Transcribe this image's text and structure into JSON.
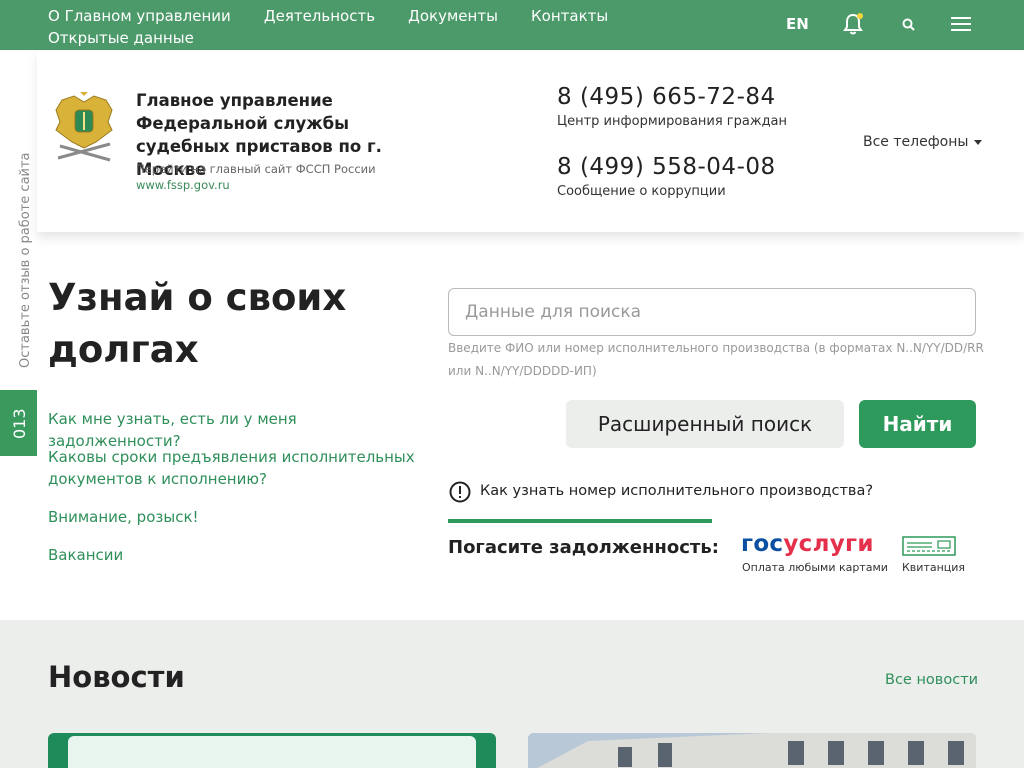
{
  "topnav": {
    "items": [
      "О Главном управлении",
      "Деятельность",
      "Документы",
      "Контакты",
      "Открытые данные"
    ],
    "lang": "EN",
    "accent": "#4c9a6a"
  },
  "header": {
    "org_title": "Главное управление Федеральной службы судебных приставов по г. Москве",
    "org_sub": "Перейти на главный сайт ФССП России",
    "org_link": "www.fssp.gov.ru",
    "phones": [
      {
        "number": "8 (495) 665-72-84",
        "label": "Центр информирования граждан"
      },
      {
        "number": "8 (499) 558-04-08",
        "label": "Сообщение о коррупции"
      }
    ],
    "all_phones": "Все телефоны"
  },
  "side": {
    "feedback": "Оставьте отзыв о работе сайта",
    "tab": "013"
  },
  "debt": {
    "title": "Узнай о своих долгах",
    "faq": [
      "Как мне узнать, есть ли у меня задолженности?",
      "Каковы сроки предъявления исполнительных документов к исполнению?",
      "Внимание, розыск!",
      "Вакансии"
    ],
    "search_placeholder": "Данные для поиска",
    "search_hint": "Введите ФИО или номер исполнительного производства (в форматах N..N/YY/DD/RR или N..N/YY/DDDDD-ИП)",
    "advanced_label": "Расширенный поиск",
    "find_label": "Найти",
    "help_link": "Как узнать номер исполнительного производства?",
    "pay_label": "Погасите задолженность:",
    "gos_part1": "гос",
    "gos_part2": "услуги",
    "gos_sub": "Оплата любыми картами",
    "receipt_label": "Квитанция"
  },
  "news": {
    "title": "Новости",
    "all_news": "Все новости"
  }
}
